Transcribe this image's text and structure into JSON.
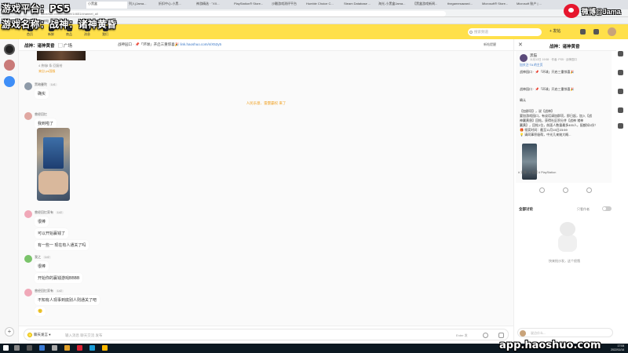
{
  "overlay": {
    "line1": "游戏平台：PS5",
    "line2": "游戏名称：战神：诸神黄昏",
    "weibo_name": "微博@Jama"
  },
  "browser": {
    "tabs": [
      "小黑盒",
      "列入(Jama... ",
      "折扣中心-小黑... ",
      "神游精选 · \"XX... ",
      "PlayStation® Store...",
      "沙雕游戏测评平台",
      "Humble Choice C...",
      "Steam Database ...",
      "海光-小黑盒Jama...",
      "【黑盒游戏新闻...",
      "thegamesaward...",
      "Microsoft® Store...",
      "Microsoft 账户 | ..."
    ],
    "url": "haoshuo.com/channel/14651/channel_all",
    "bookmarks": [
      "加州电",
      "知乎",
      "微博",
      "ps商店"
    ]
  },
  "header": {
    "nav": [
      "首页",
      "新鲜",
      "商品",
      "消息",
      "我们"
    ],
    "search_placeholder": "搜索频道",
    "publish_label": "+ 发帖"
  },
  "channel": {
    "title": "战神：诸神黄昏",
    "square_label": "▢ 广场",
    "pinned_prefix": "战神园口 · 📌「环球」开启三重惊喜🎉",
    "pinned_link": "link.haoshuo.com/s/X52y5",
    "right_label": "新帖提醒"
  },
  "messages": {
    "top_meta_pre": "4 热帖",
    "top_meta_tag": "来自 ps国服",
    "top_meta_bullets": "4 条 回复给",
    "m1_user": "黑暗曼陀",
    "m1_level": "Lv1",
    "m1_text": "确实",
    "system": "人民乐意、雷霆霸权 来了",
    "m2_user": "曾经回忆",
    "m2_text": "我到啦了",
    "photo_meta_pre": "· 4 热帖",
    "photo_meta_tag": "来自 ps国服",
    "m3_user": "曾经回忆家有",
    "m3_level": "Lv2",
    "m3_t1": "很棒",
    "m3_t2": "可以开始赢钱了",
    "m3_t3": "有一些一 现在有人通关了吗",
    "m4_user": "我之",
    "m4_level": "Lv2",
    "m4_t1": "很棒",
    "m4_t2": "开始你的赢钱游戏BBBB",
    "m5_user": "曾经回忆家有",
    "m5_level": "Lv2",
    "m5_t1": "不知有人现事到底别人则通关了吧",
    "m5_t2": "🙂"
  },
  "input": {
    "mode_label": "聊天发言",
    "placeholder": "输入消息 聊天交流 发布",
    "enter_hint": "Enter 发"
  },
  "panel": {
    "title": "战神：诸神黄昏",
    "author": "黑猫",
    "time": "11月12日 19:58 · 作者: PS5 · 战神园口",
    "follow": "加关注·TA 的主页",
    "lines": [
      "战神园口 · 📌「环球」开启三重惊喜🎉",
      "",
      "战神园口 · 📌「环球」开启三重惊喜🎉",
      "",
      "确认",
      "",
      "【加群项】，说【战神】",
      "要加游戏园口，有谈话请加群项，即日起，加入【战",
      "神赢黄昏】回帖，获得社区积分并【战神 诸神",
      "赢黄】，回帖1位，前面人数量最多400人，配额如1份！",
      "🎁 领奖时间：截至11月15日23:59",
      "💡 请同事积极帮，中光几来她大概..."
    ],
    "tags": "# 头像 · # 话题 # PlayStation",
    "all_comments": "全部讨论",
    "only_author": "只看作者",
    "empty_text": "快来抢沙发，这个很饿",
    "comment_placeholder": "说点什么..."
  },
  "taskbar": {
    "time": "17:04",
    "date": "2022/11/14"
  },
  "watermark": "app.haoshuo.com"
}
